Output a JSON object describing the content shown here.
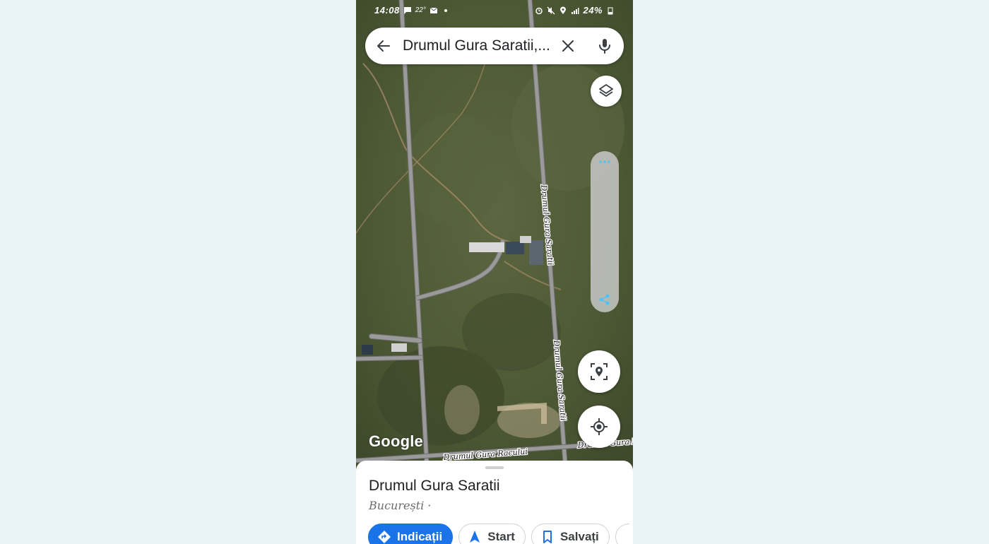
{
  "status_bar": {
    "time": "14:08",
    "temperature": "22°",
    "battery": "24%"
  },
  "search": {
    "query": "Drumul Gura Saratii,..."
  },
  "map": {
    "road_labels": [
      "Drumul Gura Saratii",
      "Drumul Gura Saratii",
      "Drumul Gura Racului",
      "Drumul Gura R"
    ],
    "attribution": "Google"
  },
  "place": {
    "title": "Drumul Gura Saratii",
    "subtitle": "București ·"
  },
  "actions": [
    {
      "label": "Indicații",
      "icon": "directions-icon"
    },
    {
      "label": "Start",
      "icon": "navigation-arrow-icon"
    },
    {
      "label": "Salvați",
      "icon": "bookmark-icon"
    }
  ],
  "colors": {
    "accent": "#1a73e8",
    "map_base": "#4f5d38"
  }
}
